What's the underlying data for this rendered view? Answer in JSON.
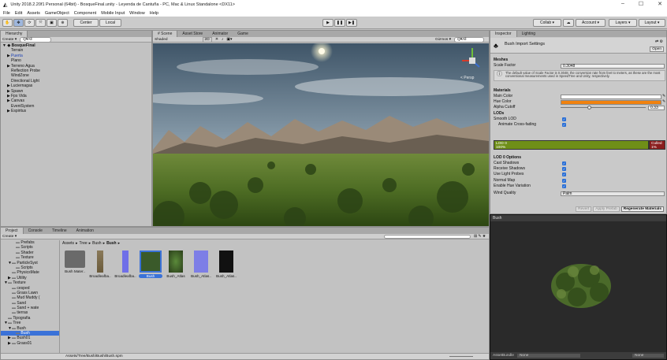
{
  "title": "Unity 2018.2.20f1 Personal (64bit) - BosqueFinal.unity - Leyenda de Cantuña - PC, Mac & Linux Standalone <DX11>",
  "window_controls": [
    "–",
    "☐",
    "✕"
  ],
  "menu": [
    "File",
    "Edit",
    "Assets",
    "GameObject",
    "Component",
    "Mobile Input",
    "Window",
    "Help"
  ],
  "toolbar": {
    "pivot": "Center",
    "space": "Local",
    "collab": "Collab ▾",
    "account": "Account ▾",
    "layers": "Layers ▾",
    "layout": "Layout ▾"
  },
  "hierarchy": {
    "tab": "Hierarchy",
    "create": "Create ▾",
    "search": "Q▾All",
    "scene": "BosqueFinal",
    "items": [
      {
        "label": "Terrain",
        "indent": 1,
        "arrow": ""
      },
      {
        "label": "Puerta",
        "indent": 1,
        "arrow": "▶",
        "blue": true
      },
      {
        "label": "Plano",
        "indent": 1,
        "arrow": ""
      },
      {
        "label": "Terreno Agua",
        "indent": 1,
        "arrow": "▶"
      },
      {
        "label": "Reflection Probe",
        "indent": 1,
        "arrow": ""
      },
      {
        "label": "WindZone",
        "indent": 1,
        "arrow": ""
      },
      {
        "label": "Directional Light",
        "indent": 1,
        "arrow": ""
      },
      {
        "label": "Luciernagas",
        "indent": 1,
        "arrow": "▶"
      },
      {
        "label": "Spawn",
        "indent": 1,
        "arrow": "▶"
      },
      {
        "label": "Fps Vida",
        "indent": 1,
        "arrow": "▶"
      },
      {
        "label": "Canvas",
        "indent": 1,
        "arrow": "▶"
      },
      {
        "label": "EventSystem",
        "indent": 1,
        "arrow": ""
      },
      {
        "label": "Espiritus",
        "indent": 1,
        "arrow": "▶"
      }
    ]
  },
  "scene": {
    "tabs": [
      "# Scene",
      "Asset Store",
      "Animator",
      "Game"
    ],
    "shaded": "Shaded",
    "mode2d": "2D",
    "gizmos": "Gizmos ▾",
    "search": "Q▾All",
    "persp": "< Persp"
  },
  "inspector": {
    "tabs": [
      "Inspector",
      "Lighting"
    ],
    "header": "Bush Import Settings",
    "open": "Open",
    "meshes": "Meshes",
    "scale_factor_label": "Scale Factor",
    "scale_factor_value": "0.3048",
    "info": "The default value of Scale Factor is 0.3048, the conversion rate from feet to meters, as these are the most conventional measurements used in SpeedTree and Unity, respectively.",
    "materials": "Materials",
    "main_color": "Main Color",
    "hue_color": "Hue Color",
    "alpha_cutoff": "Alpha Cutoff",
    "alpha_value": "0.33",
    "alpha_fraction": 0.33,
    "lods": "LODs",
    "smooth_lod": "Smooth LOD",
    "animate_crossfading": "Animate Cross-fading",
    "lod0_name": "LOD 0",
    "lod0_pct": "100%",
    "culled_name": "Culled",
    "culled_pct": "1%",
    "lod0_options": "LOD 0 Options",
    "options": [
      "Cast Shadows",
      "Receive Shadows",
      "Use Light Probes",
      "Normal Map",
      "Enable Hue Variation"
    ],
    "wind_quality": "Wind Quality",
    "wind_value": "Palm",
    "revert": "Revert",
    "apply_prefab": "Apply Prefab",
    "regenerate": "Regenerate Materials",
    "preview_title": "Bush",
    "assetbundle": "AssetBundle",
    "none1": "None",
    "none2": "None",
    "colors": {
      "hue": "#f0820f",
      "lod0": "#6f8f18",
      "culled": "#8a1e1e"
    }
  },
  "project": {
    "tabs": [
      "Project",
      "Console",
      "Timeline",
      "Animation"
    ],
    "create": "Create ▾",
    "breadcrumb": [
      "Assets",
      "Tree",
      "Bush",
      "Bush"
    ],
    "tree": [
      {
        "label": "Prefabs",
        "indent": 2
      },
      {
        "label": "Scripts",
        "indent": 2
      },
      {
        "label": "Shader",
        "indent": 2
      },
      {
        "label": "Texture",
        "indent": 2
      },
      {
        "label": "ParticleSyst",
        "indent": 1,
        "arrow": "▼"
      },
      {
        "label": "Scripts",
        "indent": 2
      },
      {
        "label": "PhysicsMate",
        "indent": 1
      },
      {
        "label": "Utility",
        "indent": 1,
        "arrow": "▶"
      },
      {
        "label": "Texture",
        "indent": 0,
        "arrow": "▼"
      },
      {
        "label": "cesped",
        "indent": 1
      },
      {
        "label": "Grass Lawn",
        "indent": 1
      },
      {
        "label": "Mud Muddy (",
        "indent": 1
      },
      {
        "label": "Sand",
        "indent": 1
      },
      {
        "label": "Sand + wate",
        "indent": 1
      },
      {
        "label": "tierras",
        "indent": 1
      },
      {
        "label": "Tipografia",
        "indent": 0
      },
      {
        "label": "Tree",
        "indent": 0,
        "arrow": "▼"
      },
      {
        "label": "Bush",
        "indent": 1,
        "arrow": "▼"
      },
      {
        "label": "Bush",
        "indent": 2,
        "selected": true
      },
      {
        "label": "Bush01",
        "indent": 1,
        "arrow": "▶"
      },
      {
        "label": "Grass01",
        "indent": 1,
        "arrow": "▶"
      }
    ],
    "assets": [
      "Bush Mater..",
      "Broadleafba..",
      "Broadleafba..",
      "Bush",
      "Bush_Atlas",
      "Bush_Atlas..",
      "Bush_Atlas.."
    ],
    "path": "Assets/Tree/Bush/Bush/Bush.spm"
  }
}
